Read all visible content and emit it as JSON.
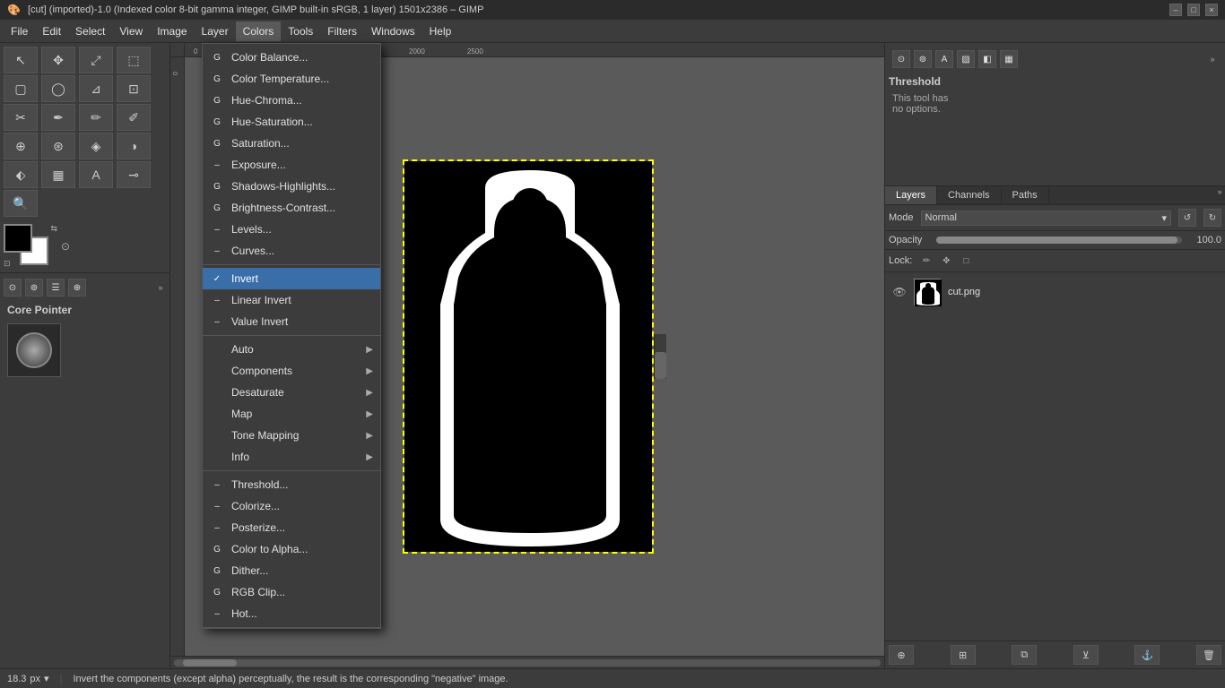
{
  "titlebar": {
    "title": "[cut] (imported)-1.0 (Indexed color 8-bit gamma integer, GIMP built-in sRGB, 1 layer) 1501x2386 – GIMP",
    "minimize": "–",
    "restore": "□",
    "close": "×"
  },
  "menubar": {
    "items": [
      "File",
      "Edit",
      "Select",
      "View",
      "Image",
      "Layer",
      "Colors",
      "Tools",
      "Filters",
      "Windows",
      "Help"
    ]
  },
  "colors_menu": {
    "sections": [
      {
        "items": [
          {
            "icon": "G",
            "label": "Color Balance...",
            "hasArrow": false
          },
          {
            "icon": "G",
            "label": "Color Temperature...",
            "hasArrow": false
          },
          {
            "icon": "G",
            "label": "Hue-Chroma...",
            "hasArrow": false
          },
          {
            "icon": "G",
            "label": "Hue-Saturation...",
            "hasArrow": false
          },
          {
            "icon": "G",
            "label": "Saturation...",
            "hasArrow": false
          },
          {
            "icon": "–",
            "label": "Exposure...",
            "hasArrow": false
          },
          {
            "icon": "G",
            "label": "Shadows-Highlights...",
            "hasArrow": false
          },
          {
            "icon": "G",
            "label": "Brightness-Contrast...",
            "hasArrow": false
          },
          {
            "icon": "–",
            "label": "Levels...",
            "hasArrow": false
          },
          {
            "icon": "–",
            "label": "Curves...",
            "hasArrow": false
          }
        ]
      },
      {
        "items": [
          {
            "icon": "✓",
            "label": "Invert",
            "highlighted": true,
            "hasArrow": false
          },
          {
            "icon": "–",
            "label": "Linear Invert",
            "hasArrow": false
          },
          {
            "icon": "–",
            "label": "Value Invert",
            "hasArrow": false
          }
        ]
      },
      {
        "items": [
          {
            "icon": "",
            "label": "Auto",
            "hasArrow": true
          },
          {
            "icon": "",
            "label": "Components",
            "hasArrow": true
          },
          {
            "icon": "",
            "label": "Desaturate",
            "hasArrow": true
          },
          {
            "icon": "",
            "label": "Map",
            "hasArrow": true
          },
          {
            "icon": "",
            "label": "Tone Mapping",
            "hasArrow": true
          },
          {
            "icon": "",
            "label": "Info",
            "hasArrow": true
          }
        ]
      },
      {
        "items": [
          {
            "icon": "–",
            "label": "Threshold...",
            "hasArrow": false
          },
          {
            "icon": "–",
            "label": "Colorize...",
            "hasArrow": false
          },
          {
            "icon": "–",
            "label": "Posterize...",
            "hasArrow": false
          },
          {
            "icon": "G",
            "label": "Color to Alpha...",
            "hasArrow": false
          },
          {
            "icon": "G",
            "label": "Dither...",
            "hasArrow": false
          },
          {
            "icon": "G",
            "label": "RGB Clip...",
            "hasArrow": false
          },
          {
            "icon": "–",
            "label": "Hot...",
            "hasArrow": false
          }
        ]
      }
    ]
  },
  "toolbox": {
    "tool_name": "Core Pointer",
    "tools": [
      "⊕",
      "↔",
      "⤡",
      "⬚",
      "◌",
      "⊡",
      "⊿",
      "▢",
      "✂",
      "⬡",
      "∿",
      "✏",
      "▷",
      "◈",
      "⬖",
      "✒",
      "⊘",
      "⊛",
      "∿",
      "⊹",
      "🔍",
      "⠿",
      "⊷",
      "⊸",
      "🔎"
    ]
  },
  "canvas": {
    "zoom_label": "px",
    "zoom_value": "18.3",
    "zoom_arrow": "▾",
    "status_text": "Invert the components (except alpha) perceptually, the result is the corresponding \"negative\" image."
  },
  "tool_options_panel": {
    "title": "Threshold",
    "note_line1": "This tool has",
    "note_line2": "no options."
  },
  "layers_panel": {
    "tabs": [
      "Layers",
      "Channels",
      "Paths"
    ],
    "mode_label": "Mode",
    "mode_value": "Normal",
    "opacity_label": "Opacity",
    "opacity_value": "100.0",
    "lock_label": "Lock:",
    "layers": [
      {
        "name": "cut.png",
        "visible": true
      }
    ]
  },
  "status_bar": {
    "unit": "px",
    "zoom": "18.3",
    "description": "Invert the components (except alpha) perceptually, the result is the corresponding \"negative\" image."
  }
}
